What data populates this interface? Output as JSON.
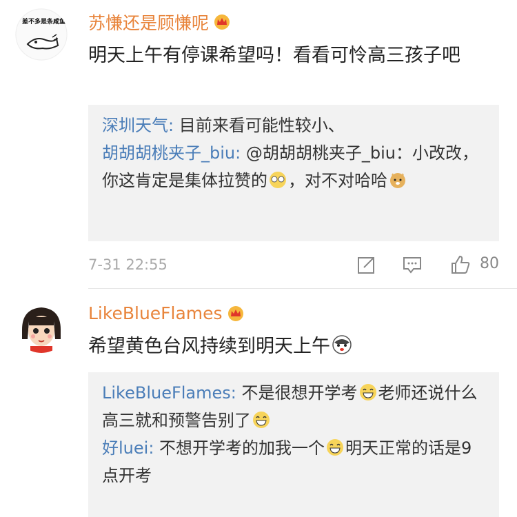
{
  "comments": [
    {
      "username": "苏慊还是顾慊呢",
      "avatar_text": "差不多是条咸鱼",
      "text": "明天上午有停课希望吗！看看可怜高三孩子吧",
      "replies": [
        {
          "name": "深圳天气",
          "sep": ":",
          "text": " 目前来看可能性较小、"
        },
        {
          "name": "胡胡胡桃夹子_biu",
          "sep": ":",
          "text": " @胡胡胡桃夹子_biu：小改改，你这肯定是集体拉赞的",
          "text2": "，对不对哈哈"
        }
      ],
      "time": "7-31 22:55",
      "likes": "80"
    },
    {
      "username": "LikeBlueFlames",
      "text": "希望黄色台风持续到明天上午",
      "replies": [
        {
          "name": "LikeBlueFlames",
          "sep": ":",
          "text": " 不是很想开学考",
          "text2": "老师还说什么高三就和预警告别了"
        },
        {
          "name": "好luei",
          "sep": ":",
          "text": " 不想开学考的加我一个",
          "text2": "明天正常的话是9点开考"
        }
      ]
    }
  ],
  "colors": {
    "username": "#e8843b",
    "reply_name": "#4a7db8",
    "reply_bg": "#f2f2f2"
  }
}
